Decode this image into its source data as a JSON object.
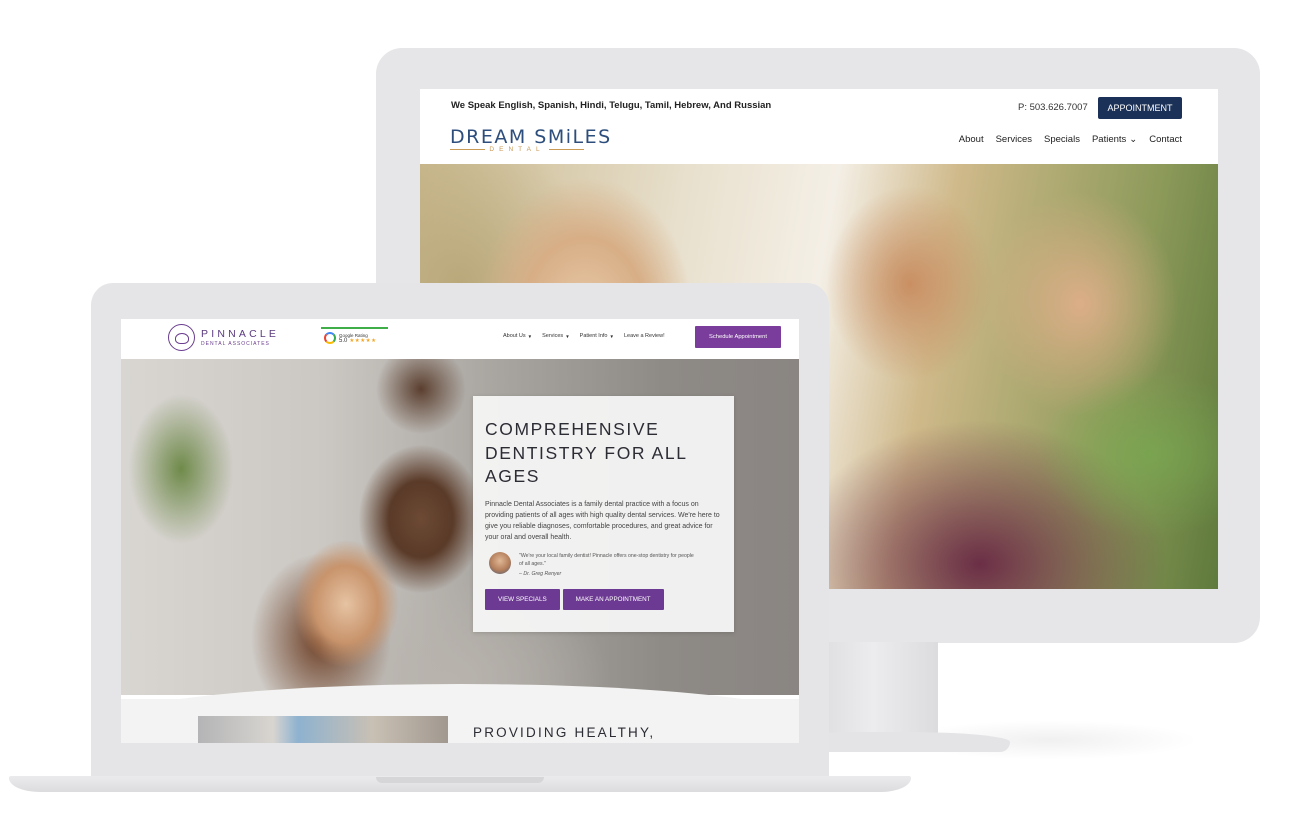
{
  "desktop_site": {
    "languages_banner": "We Speak English, Spanish, Hindi, Telugu, Tamil, Hebrew, And Russian",
    "phone": "P: 503.626.7007",
    "appointment_button": "APPOINTMENT",
    "logo": {
      "main": "DREAM SMiLES",
      "sub": "DENTAL"
    },
    "nav": [
      {
        "label": "About"
      },
      {
        "label": "Services"
      },
      {
        "label": "Specials"
      },
      {
        "label": "Patients"
      },
      {
        "label": "Contact"
      }
    ],
    "accent_color": "#1b3157"
  },
  "laptop_site": {
    "logo": {
      "main": "PINNACLE",
      "sub": "DENTAL ASSOCIATES"
    },
    "google": {
      "label": "Google Rating",
      "score": "5.0",
      "stars": "★★★★★"
    },
    "nav": [
      {
        "label": "About Us"
      },
      {
        "label": "Services"
      },
      {
        "label": "Patient Info"
      },
      {
        "label": "Leave a Review!"
      }
    ],
    "schedule_button": "Schedule Appointment",
    "hero": {
      "title": "COMPREHENSIVE DENTISTRY FOR ALL AGES",
      "body": "Pinnacle Dental Associates is a family dental practice with a focus on providing patients of all ages with high quality dental services. We're here to give you reliable diagnoses, comfortable procedures, and great advice for your oral and overall health.",
      "quote": "\"We're your local family dentist! Pinnacle offers one-stop dentistry for people of all ages.\"",
      "quote_author": "– Dr. Greg Renyer",
      "buttons": {
        "specials": "VIEW SPECIALS",
        "appointment": "MAKE AN APPOINTMENT"
      }
    },
    "section_title": "PROVIDING HEALTHY,",
    "accent_color": "#7a3d9b"
  }
}
